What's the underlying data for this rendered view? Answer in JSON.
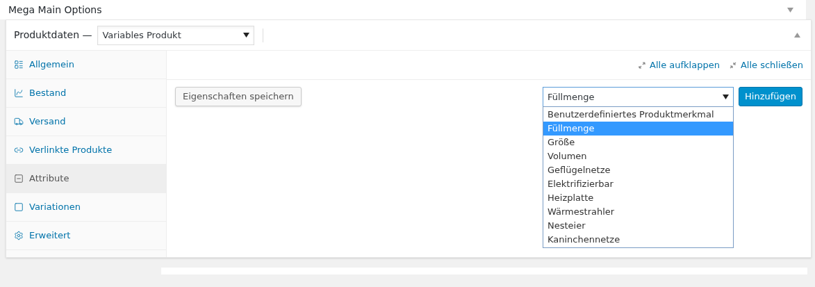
{
  "panel": {
    "title": "Mega Main Options",
    "collapsed": true
  },
  "product_data": {
    "label": "Produktdaten —",
    "type_select": {
      "value": "Variables Produkt"
    },
    "tabs": [
      {
        "label": "Allgemein",
        "kind": "general",
        "selected": false
      },
      {
        "label": "Bestand",
        "kind": "inventory",
        "selected": false
      },
      {
        "label": "Versand",
        "kind": "shipping",
        "selected": false
      },
      {
        "label": "Verlinkte Produkte",
        "kind": "linked",
        "selected": false
      },
      {
        "label": "Attribute",
        "kind": "attributes",
        "selected": true
      },
      {
        "label": "Variationen",
        "kind": "variations",
        "selected": false
      },
      {
        "label": "Erweitert",
        "kind": "advanced",
        "selected": false
      }
    ],
    "toolbar": {
      "expand_all": "Alle aufklappen",
      "close_all": "Alle schließen"
    },
    "save_button": "Eigenschaften speichern",
    "attribute_select": {
      "value": "Füllmenge",
      "expanded": true,
      "options": [
        {
          "label": "Benutzerdefiniertes Produktmerkmal",
          "selected": false
        },
        {
          "label": "Füllmenge",
          "selected": true
        },
        {
          "label": "Größe",
          "selected": false
        },
        {
          "label": "Volumen",
          "selected": false
        },
        {
          "label": "Geflügelnetze",
          "selected": false
        },
        {
          "label": "Elektrifizierbar",
          "selected": false
        },
        {
          "label": "Heizplatte",
          "selected": false
        },
        {
          "label": "Wärmestrahler",
          "selected": false
        },
        {
          "label": "Nesteier",
          "selected": false
        },
        {
          "label": "Kaninchennetze",
          "selected": false
        }
      ]
    },
    "add_button": "Hinzufügen"
  }
}
